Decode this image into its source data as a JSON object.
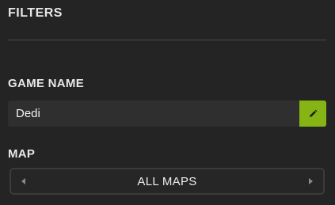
{
  "filters": {
    "title": "FILTERS"
  },
  "game_name": {
    "label": "GAME NAME",
    "value": "Dedi",
    "edit_icon": "pencil-icon",
    "accent_color": "#86b414"
  },
  "map": {
    "label": "MAP",
    "selected": "ALL MAPS",
    "prev_icon": "arrow-left-icon",
    "next_icon": "arrow-right-icon"
  }
}
